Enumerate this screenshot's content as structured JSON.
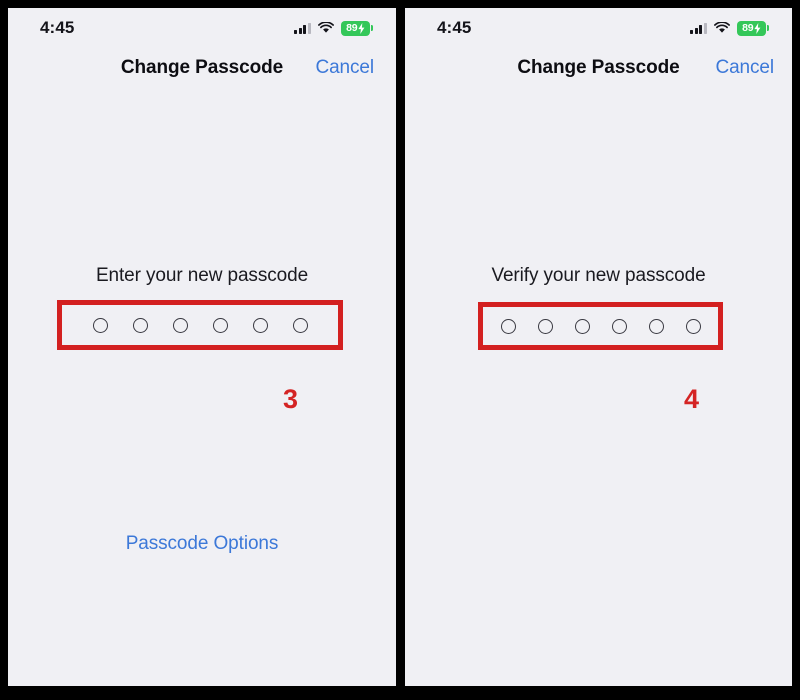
{
  "figure": {
    "background_color": "#000000",
    "panel_background": "#f0f0f4",
    "accent_blue": "#3c78d8",
    "annotation_red": "#d32020",
    "battery_green": "#34c759"
  },
  "panels": [
    {
      "id": "step-3",
      "status_bar": {
        "time": "4:45",
        "cellular_icon": "cellular-signal-icon",
        "wifi_icon": "wifi-icon",
        "battery": {
          "percent_label": "89",
          "charging_icon": "lightning-bolt-icon",
          "color": "#34c759"
        }
      },
      "nav_bar": {
        "title": "Change Passcode",
        "cancel_label": "Cancel"
      },
      "prompt": {
        "label": "Enter your new passcode",
        "dot_count": 6,
        "dots_filled": 0
      },
      "annotation": {
        "step_number": "3",
        "highlight_target": "passcode-dots"
      },
      "footer_link": "Passcode Options"
    },
    {
      "id": "step-4",
      "status_bar": {
        "time": "4:45",
        "cellular_icon": "cellular-signal-icon",
        "wifi_icon": "wifi-icon",
        "battery": {
          "percent_label": "89",
          "charging_icon": "lightning-bolt-icon",
          "color": "#34c759"
        }
      },
      "nav_bar": {
        "title": "Change Passcode",
        "cancel_label": "Cancel"
      },
      "prompt": {
        "label": "Verify your new passcode",
        "dot_count": 6,
        "dots_filled": 0
      },
      "annotation": {
        "step_number": "4",
        "highlight_target": "passcode-dots"
      },
      "footer_link": null
    }
  ]
}
